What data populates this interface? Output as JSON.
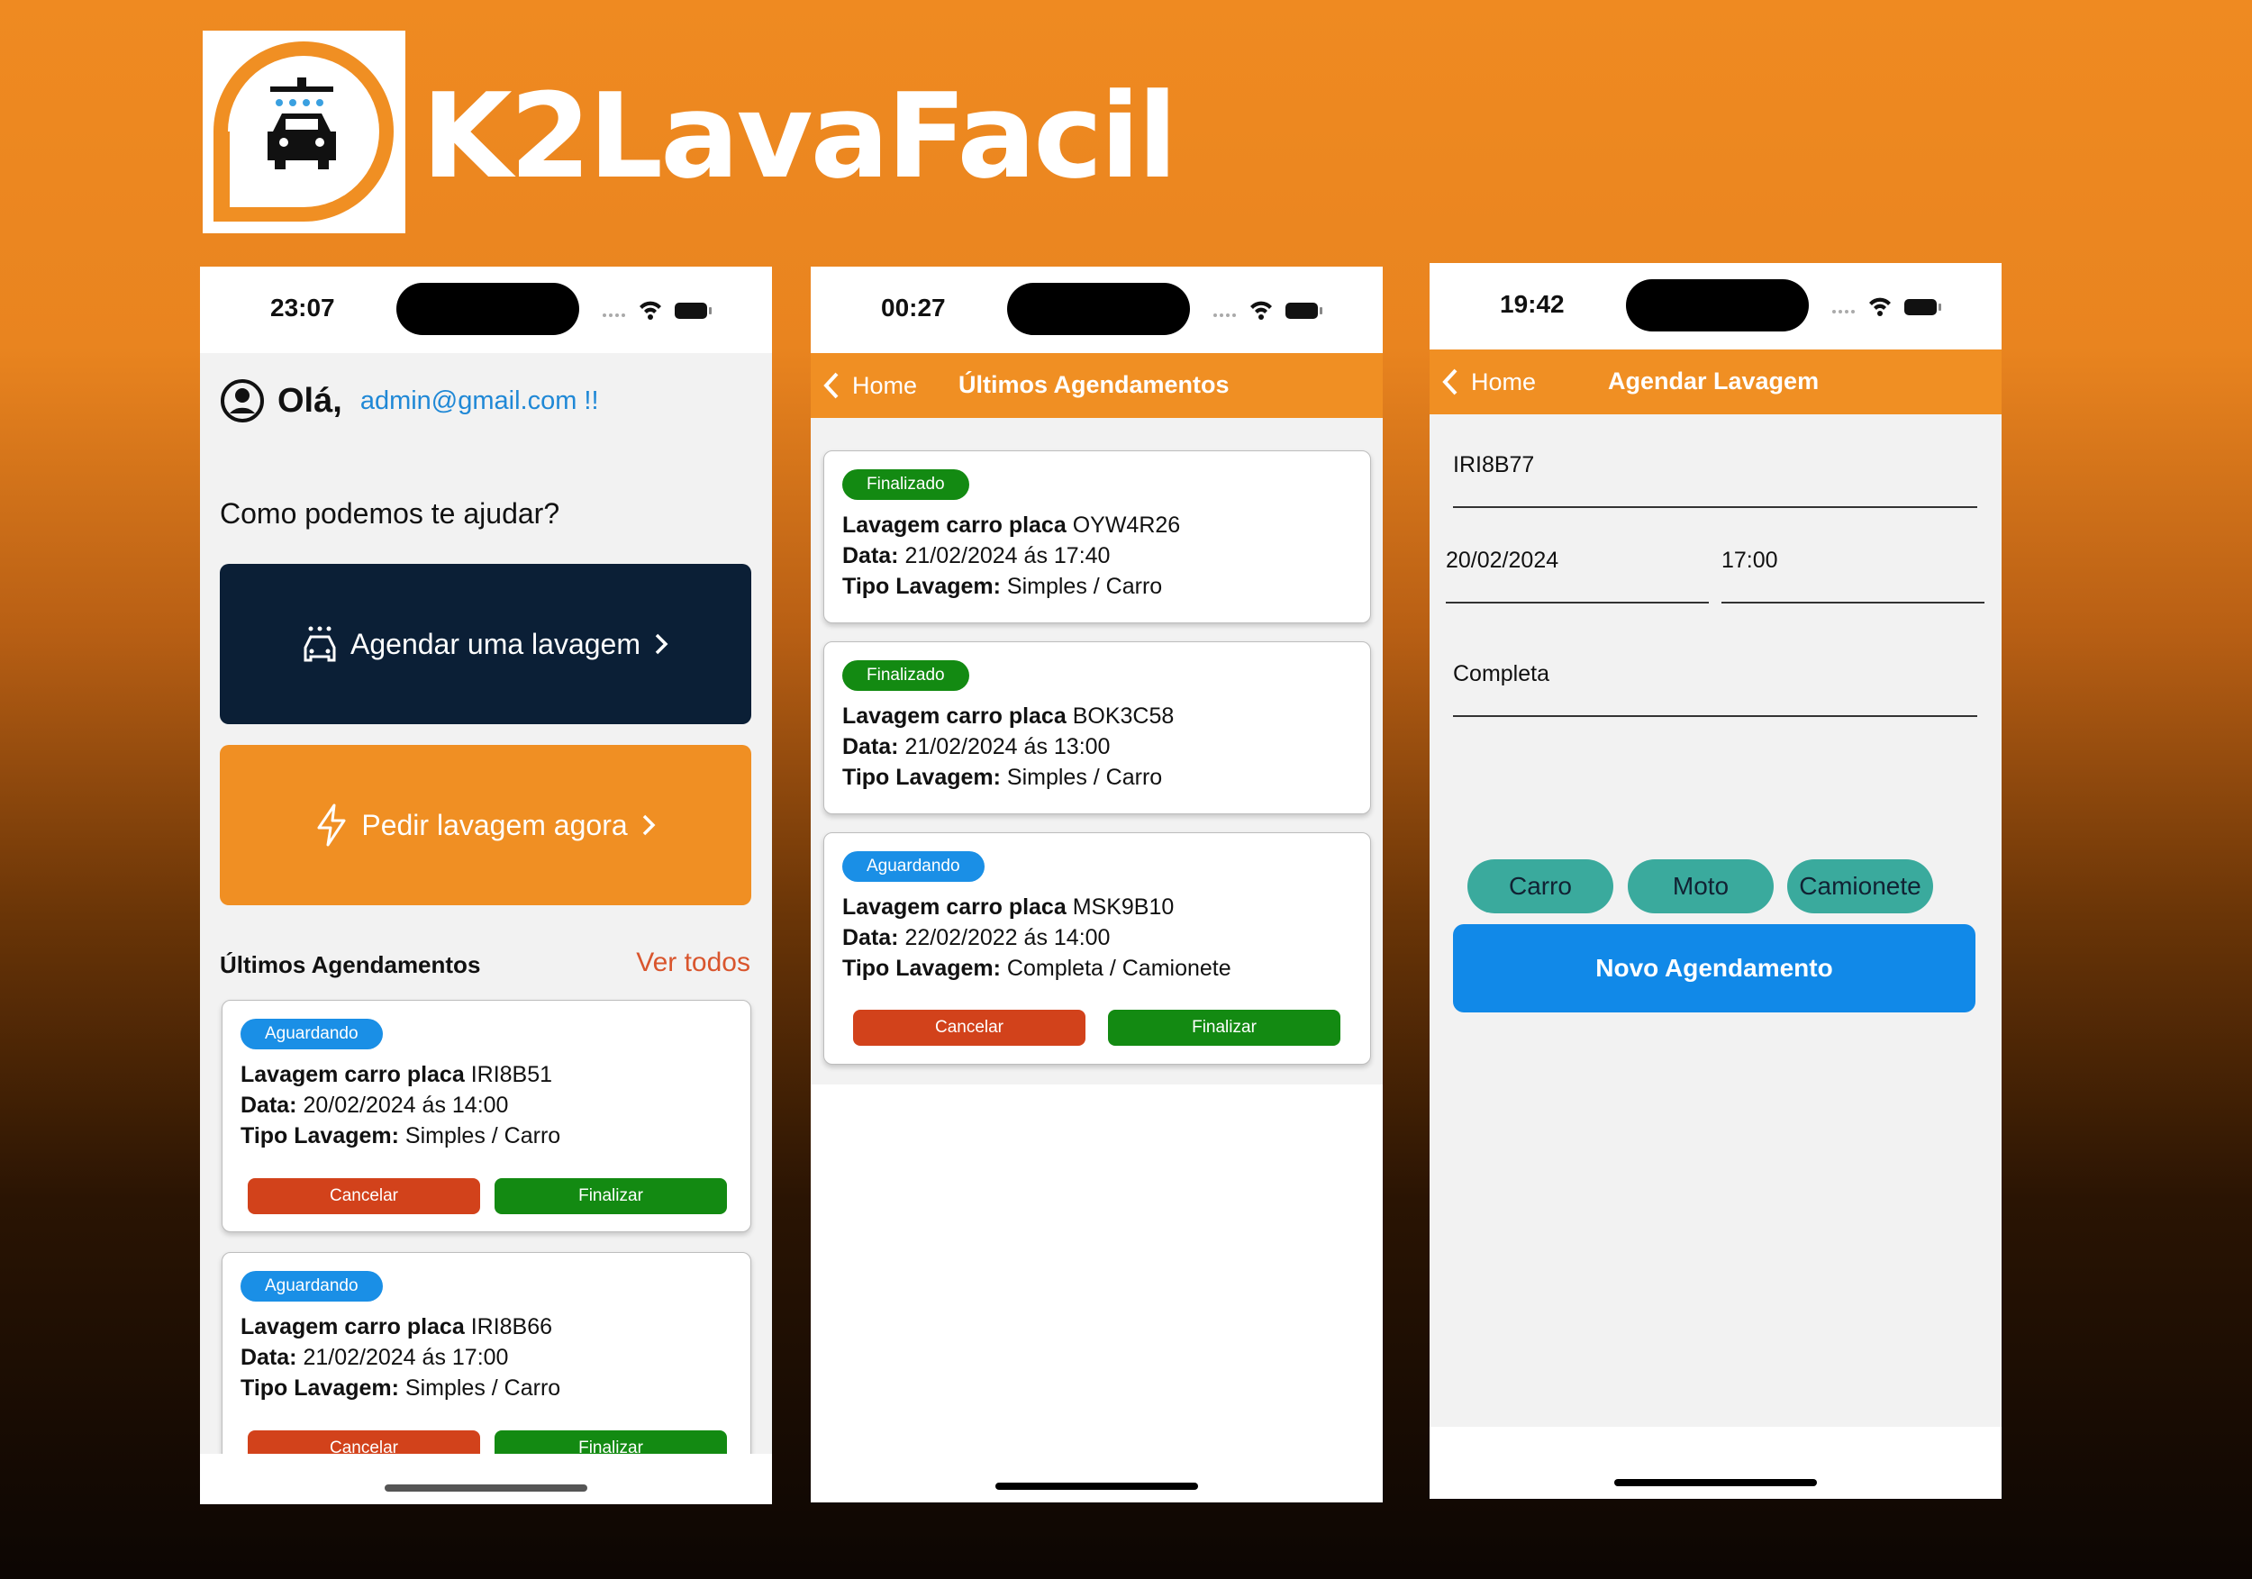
{
  "brand": {
    "name": "K2LavaFacil"
  },
  "status": {
    "phone1_time": "23:07",
    "phone2_time": "00:27",
    "phone3_time": "19:42"
  },
  "home": {
    "greeting": "Olá,",
    "email": "admin@gmail.com !!",
    "help_title": "Como podemos te ajudar?",
    "schedule_btn": "Agendar uma lavagem",
    "now_btn": "Pedir lavagem agora",
    "recent_title": "Últimos Agendamentos",
    "see_all": "Ver todos",
    "cards": [
      {
        "status": "Aguardando",
        "plate_label": "Lavagem carro placa",
        "plate": "IRI8B51",
        "date_label": "Data:",
        "date": "20/02/2024 ás 14:00",
        "type_label": "Tipo Lavagem:",
        "type": "Simples / Carro",
        "cancel": "Cancelar",
        "finish": "Finalizar"
      },
      {
        "status": "Aguardando",
        "plate_label": "Lavagem carro placa",
        "plate": "IRI8B66",
        "date_label": "Data:",
        "date": "21/02/2024 ás 17:00",
        "type_label": "Tipo Lavagem:",
        "type": "Simples / Carro",
        "cancel": "Cancelar",
        "finish": "Finalizar"
      }
    ]
  },
  "list": {
    "back": "Home",
    "title": "Últimos Agendamentos",
    "cards": [
      {
        "status": "Finalizado",
        "plate_label": "Lavagem carro placa",
        "plate": "OYW4R26",
        "date_label": "Data:",
        "date": "21/02/2024 ás 17:40",
        "type_label": "Tipo Lavagem:",
        "type": "Simples / Carro"
      },
      {
        "status": "Finalizado",
        "plate_label": "Lavagem carro placa",
        "plate": "BOK3C58",
        "date_label": "Data:",
        "date": "21/02/2024 ás 13:00",
        "type_label": "Tipo Lavagem:",
        "type": "Simples / Carro"
      },
      {
        "status": "Aguardando",
        "plate_label": "Lavagem carro placa",
        "plate": "MSK9B10",
        "date_label": "Data:",
        "date": "22/02/2022 ás 14:00",
        "type_label": "Tipo Lavagem:",
        "type": "Completa / Camionete",
        "cancel": "Cancelar",
        "finish": "Finalizar"
      }
    ]
  },
  "form": {
    "back": "Home",
    "title": "Agendar Lavagem",
    "plate": "IRI8B77",
    "date": "20/02/2024",
    "time": "17:00",
    "wash_type": "Completa",
    "vehicle_options": [
      "Carro",
      "Moto",
      "Camionete"
    ],
    "submit": "Novo Agendamento"
  },
  "colors": {
    "brand_orange": "#f08f23",
    "dark_navy": "#0b1f36",
    "status_waiting": "#1a8fe6",
    "status_done": "#138a12",
    "cancel": "#d2421b",
    "finish": "#138a12",
    "chip": "#3aaa9d",
    "primary": "#1189e8"
  }
}
